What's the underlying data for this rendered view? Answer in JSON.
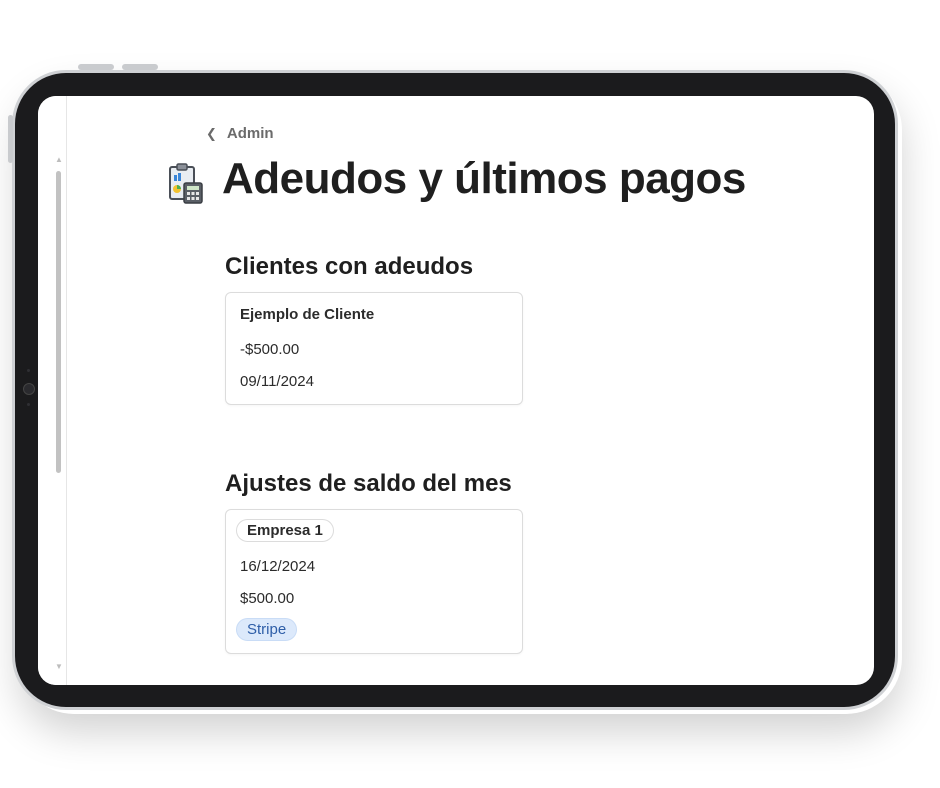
{
  "breadcrumb": {
    "label": "Admin"
  },
  "page": {
    "title": "Adeudos y últimos pagos",
    "icon": "clipboard-calculator-icon"
  },
  "debts_section": {
    "heading": "Clientes con adeudos",
    "card": {
      "client": "Ejemplo de Cliente",
      "amount": "-$500.00",
      "date": "09/11/2024"
    }
  },
  "adjustments_section": {
    "heading": "Ajustes de saldo del mes",
    "card": {
      "company": "Empresa 1",
      "date": "16/12/2024",
      "amount": "$500.00",
      "method": "Stripe"
    }
  },
  "colors": {
    "tag_blue_bg": "#dce9fb",
    "tag_blue_text": "#2e5ea8",
    "frame": "#1b1b1d"
  }
}
